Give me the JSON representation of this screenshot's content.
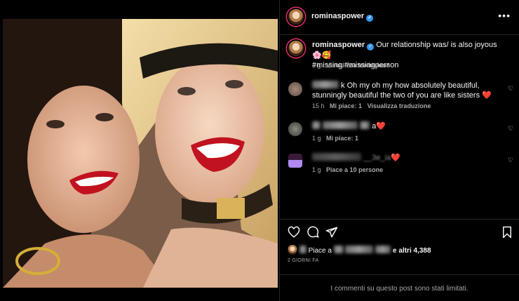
{
  "post": {
    "username": "rominaspower",
    "caption_text": "Our relationship was/ is also joyous",
    "caption_emoji": "🌸🥰",
    "hashtags": "#missing #missingperson",
    "caption_age": "2 g",
    "translate_label": "Visualizza traduzione",
    "more_label": "•••"
  },
  "comments": [
    {
      "text": "k Oh my oh my how absolutely beautiful, stunningly beautiful the two of you are like sisters",
      "emoji": "❤️",
      "age": "15 h",
      "likes": "Mi piace: 1",
      "translate_label": "Visualizza traduzione"
    },
    {
      "text": "a",
      "emoji": "❤️",
      "age": "1 g",
      "likes": "Mi piace: 1"
    },
    {
      "text": "__3e_ia",
      "emoji": "❤️",
      "age": "1 g",
      "likes": "Piace a 10 persone"
    }
  ],
  "footer": {
    "likes_prefix": "Piace a",
    "likes_suffix": "e altri 4,388",
    "date": "2 GIORNI FA",
    "limited_notice": "I commenti su questo post sono stati limitati."
  },
  "icons": {
    "heart": "heart-icon",
    "comment": "comment-icon",
    "share": "share-icon",
    "save": "bookmark-icon",
    "verified": "verified-badge-icon",
    "more": "more-options-icon"
  },
  "colors": {
    "background": "#000000",
    "text": "#f5f5f5",
    "secondary": "#a8a8a8",
    "verified": "#3897f0",
    "story_ring": "#e1306c",
    "red_heart": "#ff2d55"
  }
}
